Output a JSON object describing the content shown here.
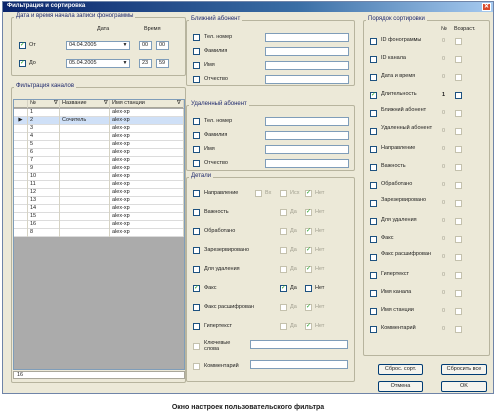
{
  "window": {
    "title": "Фильтрация и сортировка",
    "close_glyph": "✕"
  },
  "datetime": {
    "group_title": "Дата и время начала записи фонограммы",
    "col_date": "Дата",
    "col_time": "Время",
    "from": {
      "label": "От",
      "checked": true,
      "date": "04.04.2005",
      "hours": "00",
      "minutes": "00"
    },
    "to": {
      "label": "До",
      "checked": true,
      "date": "05.04.2005",
      "hours": "23",
      "minutes": "59"
    }
  },
  "channel_filter": {
    "group_title": "Фильтрация каналов",
    "headers": {
      "num": "№",
      "name": "Название",
      "station": "Имя станции"
    },
    "rows": [
      {
        "num": "1",
        "name": "",
        "station": "alex-xp"
      },
      {
        "num": "2",
        "name": "Сочитель",
        "station": "alex-xp"
      },
      {
        "num": "3",
        "name": "",
        "station": "alex-xp"
      },
      {
        "num": "4",
        "name": "",
        "station": "alex-xp"
      },
      {
        "num": "5",
        "name": "",
        "station": "alex-xp"
      },
      {
        "num": "6",
        "name": "",
        "station": "alex-xp"
      },
      {
        "num": "7",
        "name": "",
        "station": "alex-xp"
      },
      {
        "num": "9",
        "name": "",
        "station": "alex-xp"
      },
      {
        "num": "10",
        "name": "",
        "station": "alex-xp"
      },
      {
        "num": "11",
        "name": "",
        "station": "alex-xp"
      },
      {
        "num": "12",
        "name": "",
        "station": "alex-xp"
      },
      {
        "num": "13",
        "name": "",
        "station": "alex-xp"
      },
      {
        "num": "14",
        "name": "",
        "station": "alex-xp"
      },
      {
        "num": "15",
        "name": "",
        "station": "alex-xp"
      },
      {
        "num": "16",
        "name": "",
        "station": "alex-xp"
      },
      {
        "num": "8",
        "name": "",
        "station": "alex-xp"
      }
    ],
    "selected_index": 1,
    "count": "16"
  },
  "near_subscriber": {
    "group_title": "Ближний абонент",
    "fields": [
      "Тел. номер",
      "Фамилия",
      "Имя",
      "Отчество"
    ]
  },
  "remote_subscriber": {
    "group_title": "Удаленный абонент",
    "fields": [
      "Тел. номер",
      "Фамилия",
      "Имя",
      "Отчество"
    ]
  },
  "details": {
    "group_title": "Детали",
    "rows": [
      {
        "label": "Направление",
        "checked": false,
        "opts": [
          "Вх",
          "Исх"
        ],
        "opt_checked": [
          false,
          false,
          true
        ],
        "third": "Нет"
      },
      {
        "label": "Важность",
        "checked": false,
        "opts": [
          "Да"
        ],
        "opt_checked": [
          false,
          true
        ],
        "third": "Нет"
      },
      {
        "label": "Обработано",
        "checked": false,
        "opts": [
          "Да"
        ],
        "opt_checked": [
          false,
          true
        ],
        "third": "Нет"
      },
      {
        "label": "Зарезервировано",
        "checked": false,
        "opts": [
          "Да"
        ],
        "opt_checked": [
          false,
          true
        ],
        "third": "Нет"
      },
      {
        "label": "Для удаления",
        "checked": false,
        "opts": [
          "Да"
        ],
        "opt_checked": [
          false,
          true
        ],
        "third": "Нет"
      },
      {
        "label": "Факс",
        "checked": true,
        "opts": [
          "Да"
        ],
        "opt_checked": [
          true,
          false
        ],
        "third": "Нет"
      },
      {
        "label": "Факс расшифрован",
        "checked": false,
        "opts": [
          "Да"
        ],
        "opt_checked": [
          false,
          true
        ],
        "third": "Нет"
      },
      {
        "label": "Гипертекст",
        "checked": false,
        "opts": [
          "Да"
        ],
        "opt_checked": [
          false,
          true
        ],
        "third": "Нет"
      }
    ],
    "keywords_label": "Ключевые слова",
    "comment_label": "Комментарий"
  },
  "sort": {
    "group_title": "Порядок сортировки",
    "col_num": "№",
    "col_asc": "Возраст.",
    "items": [
      {
        "label": "ID фонограммы",
        "checked": false,
        "num": "0"
      },
      {
        "label": "ID канала",
        "checked": false,
        "num": "0"
      },
      {
        "label": "Дата и время",
        "checked": false,
        "num": "0"
      },
      {
        "label": "Длительность",
        "checked": true,
        "num": "1"
      },
      {
        "label": "Ближний абонент",
        "checked": false,
        "num": "0"
      },
      {
        "label": "Удаленный абонент",
        "checked": false,
        "num": "0"
      },
      {
        "label": "Направление",
        "checked": false,
        "num": "0"
      },
      {
        "label": "Важность",
        "checked": false,
        "num": "0"
      },
      {
        "label": "Обработано",
        "checked": false,
        "num": "0"
      },
      {
        "label": "Зарезервировано",
        "checked": false,
        "num": "0"
      },
      {
        "label": "Для удаления",
        "checked": false,
        "num": "0"
      },
      {
        "label": "Факс",
        "checked": false,
        "num": "0"
      },
      {
        "label": "Факс расшифрован",
        "checked": false,
        "num": "0"
      },
      {
        "label": "Гипертекст",
        "checked": false,
        "num": "0"
      },
      {
        "label": "Имя канала",
        "checked": false,
        "num": "0"
      },
      {
        "label": "Имя станции",
        "checked": false,
        "num": "0"
      },
      {
        "label": "Комментарий",
        "checked": false,
        "num": "0"
      }
    ]
  },
  "buttons": {
    "reset_sort": "Сброс. сорт.",
    "reset_all": "Сбросить все",
    "cancel": "Отмена",
    "ok": "OK"
  },
  "caption": "Окно настроек пользовательского фильтра"
}
